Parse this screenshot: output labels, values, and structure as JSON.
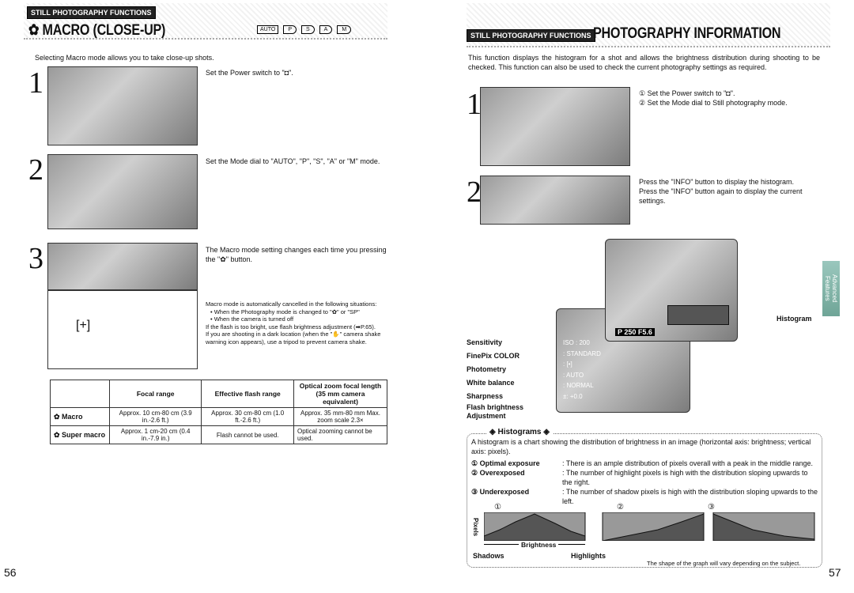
{
  "left": {
    "section_tag": "STILL PHOTOGRAPHY FUNCTIONS",
    "title": "✿ MACRO (CLOSE-UP)",
    "mode_icons": [
      "AUTO",
      "P",
      "S",
      "A",
      "M"
    ],
    "intro": "Selecting Macro mode allows you to take close-up shots.",
    "steps": [
      {
        "num": "1",
        "text": "Set the Power switch to \"◘\"."
      },
      {
        "num": "2",
        "text": "Set the Mode dial to \"AUTO\", \"P\", \"S\", \"A\" or \"M\" mode."
      },
      {
        "num": "3",
        "text": "The Macro mode setting changes each time you pressing the \"✿\" button."
      }
    ],
    "notes": [
      "Macro mode is automatically cancelled in the following situations:",
      "• When the Photography mode is changed to \"✿\" or \"SP\"",
      "• When the camera is turned off",
      "If the flash is too bright, use flash brightness adjustment (➡P.65).",
      "If you are shooting in a dark location (when the \"✋\" camera shake warning icon appears), use a tripod to prevent camera shake."
    ],
    "table": {
      "headers": [
        "",
        "Focal range",
        "Effective flash range",
        "Optical zoom focal length (35 mm camera equivalent)"
      ],
      "rows": [
        [
          "✿ Macro",
          "Approx. 10 cm-80 cm (3.9 in.-2.6 ft.)",
          "Approx. 30 cm-80 cm (1.0 ft.-2.6 ft.)",
          "Approx. 35 mm-80 mm Max. zoom scale 2.3×"
        ],
        [
          "✿ Super macro",
          "Approx. 1 cm-20 cm (0.4 in.-7.9 in.)",
          "Flash cannot be used.",
          "Optical zooming cannot be used."
        ]
      ]
    },
    "page_number": "56"
  },
  "right": {
    "section_tag": "STILL PHOTOGRAPHY FUNCTIONS",
    "title": "PHOTOGRAPHY INFORMATION",
    "intro": "This function displays the histogram for a shot and allows the brightness distribution during shooting to be checked. This function can also be used to check the current photography settings as required.",
    "steps": [
      {
        "num": "1",
        "lines": [
          "① Set the Power switch to \"◘\".",
          "② Set the Mode dial to Still photography mode."
        ]
      },
      {
        "num": "2",
        "lines": [
          "Press the \"INFO\" button to display the histogram.",
          "Press the \"INFO\" button again to display the current settings."
        ]
      }
    ],
    "labels": [
      "Sensitivity",
      "FinePix COLOR",
      "Photometry",
      "White balance",
      "Sharpness",
      "Flash brightness Adjustment"
    ],
    "screen_values": [
      "ISO : 200",
      ": STANDARD",
      ": [•]",
      ": AUTO",
      ": NORMAL",
      "±: +0.0",
      "P 250 F5.6"
    ],
    "histogram_label": "Histogram",
    "side_tab": "Advanced Features",
    "box": {
      "title": "◈ Histograms ◈",
      "desc": "A histogram is a chart showing the distribution of brightness in an image (horizontal axis: brightness; vertical axis: pixels).",
      "items": [
        {
          "term": "① Optimal exposure",
          "desc": ": There is an ample distribution of pixels overall with a peak in the middle range."
        },
        {
          "term": "② Overexposed",
          "desc": ": The number of highlight pixels is high with the distribution sloping upwards to the right."
        },
        {
          "term": "③ Underexposed",
          "desc": ": The number of shadow pixels is high with the distribution sloping upwards to the left."
        }
      ],
      "markers": [
        "①",
        "②",
        "③"
      ],
      "y_axis": "Pixels",
      "x_axis": "Brightness",
      "shadows": "Shadows",
      "highlights": "Highlights",
      "note": "The shape of the graph will vary depending on the subject."
    },
    "page_number": "57"
  }
}
